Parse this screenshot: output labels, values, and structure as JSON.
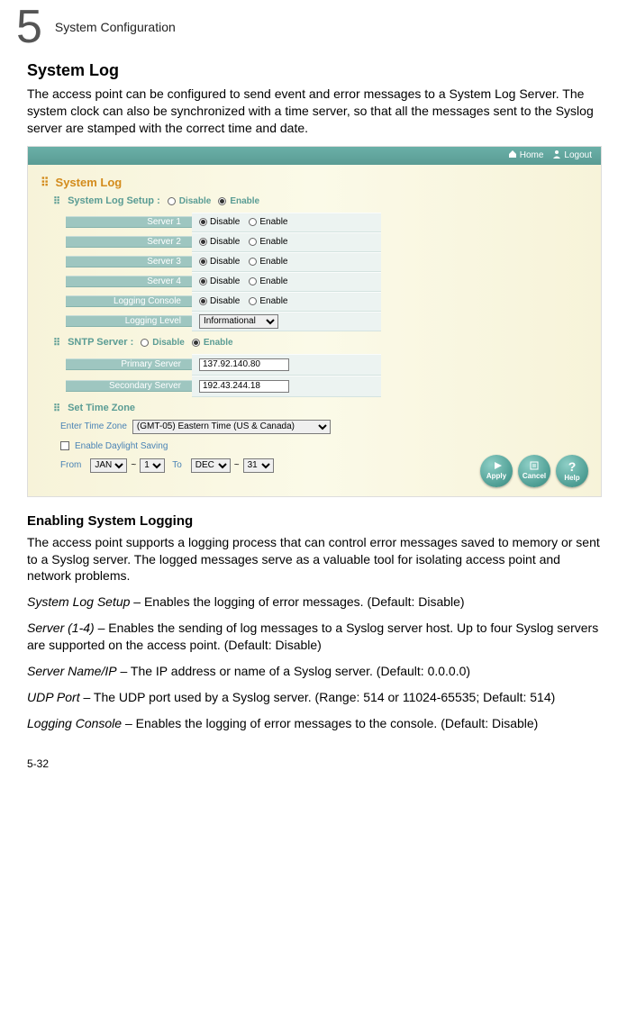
{
  "chapter": {
    "num": "5",
    "title": "System Configuration"
  },
  "heading1": "System Log",
  "intro_para": "The access point can be configured to send event and error messages to a System Log Server. The system clock can also be synchronized with a time server, so that all the messages sent to the Syslog server are stamped with the correct time and date.",
  "topbar": {
    "home": "Home",
    "logout": "Logout"
  },
  "syslog": {
    "section_title": "System Log",
    "setup_label": "System Log Setup  :",
    "disable": "Disable",
    "enable": "Enable",
    "rows": [
      {
        "label": "Server 1"
      },
      {
        "label": "Server 2"
      },
      {
        "label": "Server 3"
      },
      {
        "label": "Server 4"
      },
      {
        "label": "Logging Console"
      }
    ],
    "logging_level_label": "Logging Level",
    "logging_level_value": "Informational"
  },
  "sntp": {
    "setup_label": "SNTP Server  :",
    "primary_label": "Primary Server",
    "primary_value": "137.92.140.80",
    "secondary_label": "Secondary Server",
    "secondary_value": "192.43.244.18"
  },
  "tz": {
    "section_title": "Set Time Zone",
    "enter_label": "Enter Time Zone",
    "value": "(GMT-05) Eastern Time (US & Canada)",
    "dst_label": "Enable Daylight Saving",
    "from": "From",
    "to": "To",
    "from_month": "JAN",
    "from_day": "1",
    "to_month": "DEC",
    "to_day": "31"
  },
  "buttons": {
    "apply": "Apply",
    "cancel": "Cancel",
    "help": "Help"
  },
  "heading2": "Enabling System Logging",
  "para2": "The access point supports a logging process that can control error messages saved to memory or sent to a Syslog server. The logged messages serve as a valuable tool for isolating access point and network problems.",
  "defs": {
    "setup_k": "System Log Setup",
    "setup_v": " – Enables the logging of error messages. (Default: Disable)",
    "server_k": "Server (1-4)",
    "server_v": " – Enables the sending of log messages to a Syslog server host. Up to four Syslog servers are supported on the access point. (Default: Disable)",
    "name_k": "Server Name/IP",
    "name_v": " – The IP address or name of a Syslog server. (Default: 0.0.0.0)",
    "udp_k": "UDP Port",
    "udp_v": " – The UDP port used by a Syslog server. (Range: 514 or 11024-65535; Default: 514)",
    "console_k": "Logging Console",
    "console_v": " – Enables the logging of error messages to the console. (Default: Disable)"
  },
  "pagenum": "5-32"
}
